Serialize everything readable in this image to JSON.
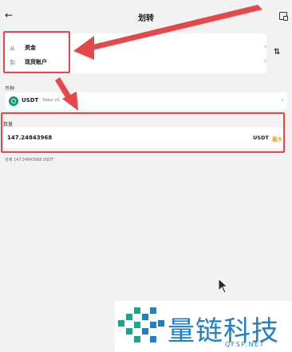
{
  "header": {
    "title": "划转",
    "back_icon": "arrow-left-icon",
    "history_icon": "document-icon"
  },
  "transfer": {
    "from_label": "从",
    "from_value": "资金",
    "to_label": "到",
    "to_value": "现货账户",
    "swap_glyph": "⇅"
  },
  "coin": {
    "section_label": "币种",
    "symbol": "USDT",
    "name": "Tether US"
  },
  "amount": {
    "section_label": "数量",
    "value": "147.24843968",
    "unit": "USDT",
    "max_label": "最大",
    "available": "可用 147.24843968 USDT"
  },
  "watermark": {
    "title": "量链科技",
    "subtitle": "QFSP.NET"
  },
  "colors": {
    "annotation_red": "#e5474a",
    "accent_max": "#e5a100",
    "coin_green": "#0c9c7a",
    "watermark_blue": "#1f7fc9"
  }
}
